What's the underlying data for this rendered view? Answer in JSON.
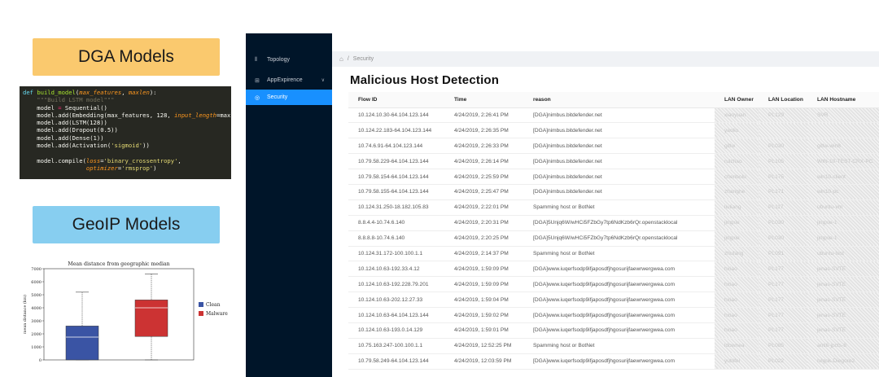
{
  "left": {
    "dga_title": "DGA Models",
    "geoip_title": "GeoIP Models",
    "code_lines": [
      [
        {
          "t": "def ",
          "c": "kw"
        },
        {
          "t": "build_model",
          "c": "fn"
        },
        {
          "t": "(",
          "c": "p"
        },
        {
          "t": "max_features",
          "c": "arg"
        },
        {
          "t": ", ",
          "c": "p"
        },
        {
          "t": "maxlen",
          "c": "arg"
        },
        {
          "t": "):",
          "c": "p"
        }
      ],
      [
        {
          "t": "    \"\"\"Build LSTM model\"\"\"",
          "c": "com"
        }
      ],
      [
        {
          "t": "    model ",
          "c": "p"
        },
        {
          "t": "=",
          "c": "op"
        },
        {
          "t": " Sequential()",
          "c": "p"
        }
      ],
      [
        {
          "t": "    model.add(Embedding(max_features, 128, ",
          "c": "p"
        },
        {
          "t": "input_length",
          "c": "arg"
        },
        {
          "t": "=maxlen))",
          "c": "p"
        }
      ],
      [
        {
          "t": "    model.add(LSTM(128))",
          "c": "p"
        }
      ],
      [
        {
          "t": "    model.add(Dropout(0.5))",
          "c": "p"
        }
      ],
      [
        {
          "t": "    model.add(Dense(1))",
          "c": "p"
        }
      ],
      [
        {
          "t": "    model.add(Activation(",
          "c": "p"
        },
        {
          "t": "'sigmoid'",
          "c": "str"
        },
        {
          "t": "))",
          "c": "p"
        }
      ],
      [
        {
          "t": "",
          "c": "p"
        }
      ],
      [
        {
          "t": "    model.compile(",
          "c": "p"
        },
        {
          "t": "loss",
          "c": "arg"
        },
        {
          "t": "=",
          "c": "p"
        },
        {
          "t": "'binary_crossentropy'",
          "c": "str"
        },
        {
          "t": ",",
          "c": "p"
        }
      ],
      [
        {
          "t": "                  ",
          "c": "p"
        },
        {
          "t": "optimizer",
          "c": "arg"
        },
        {
          "t": "=",
          "c": "p"
        },
        {
          "t": "'rmsprop'",
          "c": "str"
        },
        {
          "t": ")",
          "c": "p"
        }
      ],
      [
        {
          "t": "",
          "c": "p"
        }
      ],
      [
        {
          "t": "    return ",
          "c": "op"
        },
        {
          "t": "model",
          "c": "p"
        }
      ]
    ]
  },
  "chart_data": {
    "type": "box",
    "title": "Mean distance from geographic median",
    "ylabel": "mean distance (km)",
    "ylim": [
      0,
      7000
    ],
    "yticks": [
      0,
      1000,
      2000,
      3000,
      4000,
      5000,
      6000,
      7000
    ],
    "series": [
      {
        "name": "Clean",
        "color": "#3a54a4",
        "min": 0,
        "q1": 0,
        "median": 1750,
        "q3": 2600,
        "max": 5200
      },
      {
        "name": "Malware",
        "color": "#cc3333",
        "min": 0,
        "q1": 1800,
        "median": 4000,
        "q3": 4600,
        "max": 6600
      }
    ],
    "legend_position": "right"
  },
  "app": {
    "sidebar": [
      {
        "label": "Topology",
        "icon": "chart-icon",
        "glyph": "⫴"
      },
      {
        "label": "AppExpirence",
        "icon": "appstore-icon",
        "glyph": "⊞",
        "chevron": "∨"
      },
      {
        "label": "Security",
        "icon": "shield-icon",
        "glyph": "◎",
        "active": true
      }
    ],
    "breadcrumb": {
      "home_glyph": "⌂",
      "sep": "/",
      "current": "Security"
    },
    "title": "Malicious Host Detection",
    "columns": [
      "Flow ID",
      "Time",
      "reason",
      "LAN Owner",
      "LAN Location",
      "LAN Hostname"
    ],
    "rows": [
      [
        "10.124.10.30-64.104.123.144",
        "4/24/2019, 2:26:41 PM",
        "[DGA]nimbus.bitdefender.net",
        "xiaoyuan",
        "PL129",
        "SVR"
      ],
      [
        "10.124.22.183-64.104.123.144",
        "4/24/2019, 2:26:35 PM",
        "[DGA]nimbus.bitdefender.net",
        "yaoliu",
        "",
        ""
      ],
      [
        "10.74.6.91-64.104.123.144",
        "4/24/2019, 2:26:33 PM",
        "[DGA]nimbus.bitdefender.net",
        "gitlw",
        "PL030",
        "gitlw-win8"
      ],
      [
        "10.79.58.229-64.104.123.144",
        "4/24/2019, 2:26:14 PM",
        "[DGA]nimbus.bitdefender.net",
        "ruizhao",
        "PL105",
        "WIN-10-TEST-CRX-PC"
      ],
      [
        "10.79.58.154-64.104.123.144",
        "4/24/2019, 2:25:59 PM",
        "[DGA]nimbus.bitdefender.net",
        "chenbolu",
        "PL175",
        "win10-client"
      ],
      [
        "10.79.58.155-64.104.123.144",
        "4/24/2019, 2:25:47 PM",
        "[DGA]nimbus.bitdefender.net",
        "zhanghe",
        "PL171",
        "win10-pc"
      ],
      [
        "10.124.31.250-18.182.105.83",
        "4/24/2019, 2:22:01 PM",
        "Spamming host or BotNet",
        "liuliang",
        "PL117",
        "ubuntu-vm"
      ],
      [
        "8.8.4.4-10.74.6.140",
        "4/24/2019, 2:20:31 PM",
        "[DGA]5Unjq6W/wHCi5FZbGy7tp6NdKzb6rQr.openstacklocal",
        "jingxie",
        "PL030",
        "jingxie-1"
      ],
      [
        "8.8.8.8-10.74.6.140",
        "4/24/2019, 2:20:25 PM",
        "[DGA]5Unjq6W/wHCi5FZbGy7tp6NdKzb6rQr.openstacklocal",
        "jingxie",
        "PL030",
        "jingxie-1"
      ],
      [
        "10.124.31.172-100.100.1.1",
        "4/24/2019, 2:14:37 PM",
        "Spamming host or BotNet",
        "zhufang",
        "PL091",
        "ubuntu-test"
      ],
      [
        "10.124.10.63-192.33.4.12",
        "4/24/2019, 1:59:09 PM",
        "[DGA]www.iuqerfsodp9ifjaposdfjhgosurijfaewrwergwea.com",
        "hxiao",
        "PL177",
        "jenas-SVTE"
      ],
      [
        "10.124.10.63-192.228.79.201",
        "4/24/2019, 1:59:09 PM",
        "[DGA]www.iuqerfsodp9ifjaposdfjhgosurijfaewrwergwea.com",
        "hxiao",
        "PL177",
        "jenas-SVTE"
      ],
      [
        "10.124.10.63-202.12.27.33",
        "4/24/2019, 1:59:04 PM",
        "[DGA]www.iuqerfsodp9ifjaposdfjhgosurijfaewrwergwea.com",
        "hxiao",
        "PL177",
        "jenas-SVTE"
      ],
      [
        "10.124.10.63-64.104.123.144",
        "4/24/2019, 1:59:02 PM",
        "[DGA]www.iuqerfsodp9ifjaposdfjhgosurijfaewrwergwea.com",
        "hxiao",
        "PL177",
        "jenas-SVTE"
      ],
      [
        "10.124.10.63-193.0.14.129",
        "4/24/2019, 1:59:01 PM",
        "[DGA]www.iuqerfsodp9ifjaposdfjhgosurijfaewrwergwea.com",
        "hxiao",
        "PL177",
        "jenas-SVTE"
      ],
      [
        "10.75.163.247-100.100.1.1",
        "4/24/2019, 12:52:25 PM",
        "Spamming host or BotNet",
        "ldownea",
        "PL085",
        "anti6-jpcts-8"
      ],
      [
        "10.79.58.249-64.104.123.144",
        "4/24/2019, 12:03:59 PM",
        "[DGA]www.iuqerfsodp9ifjaposdfjhgosurijfaewrwergwea.com",
        "yubifei",
        "PL022",
        "Ivlgok-Diegore2"
      ]
    ]
  }
}
